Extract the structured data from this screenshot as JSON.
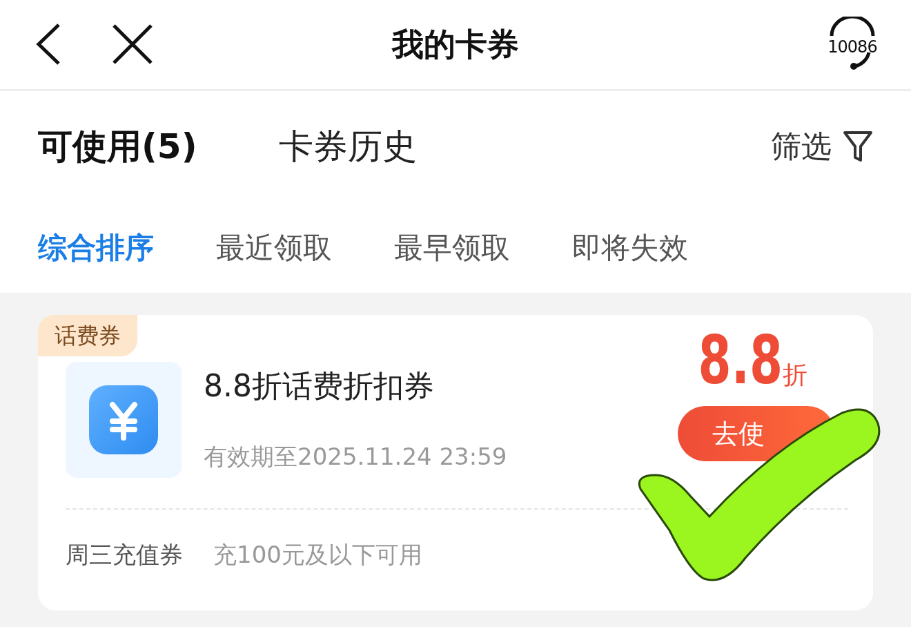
{
  "header": {
    "title": "我的卡券",
    "support_label": "10086"
  },
  "tabs": [
    {
      "label": "可使用(5)",
      "selected": true
    },
    {
      "label": "卡券历史",
      "selected": false
    }
  ],
  "filter": {
    "label": "筛选"
  },
  "sorts": [
    {
      "label": "综合排序",
      "selected": true
    },
    {
      "label": "最近领取",
      "selected": false
    },
    {
      "label": "最早领取",
      "selected": false
    },
    {
      "label": "即将失效",
      "selected": false
    }
  ],
  "coupons": [
    {
      "tag": "话费券",
      "title": "8.8折话费折扣券",
      "validity": "有效期至2025.11.24 23:59",
      "value": "8.8",
      "unit": "折",
      "button": "去使",
      "name": "周三充值券",
      "condition": "充100元及以下可用"
    }
  ]
}
